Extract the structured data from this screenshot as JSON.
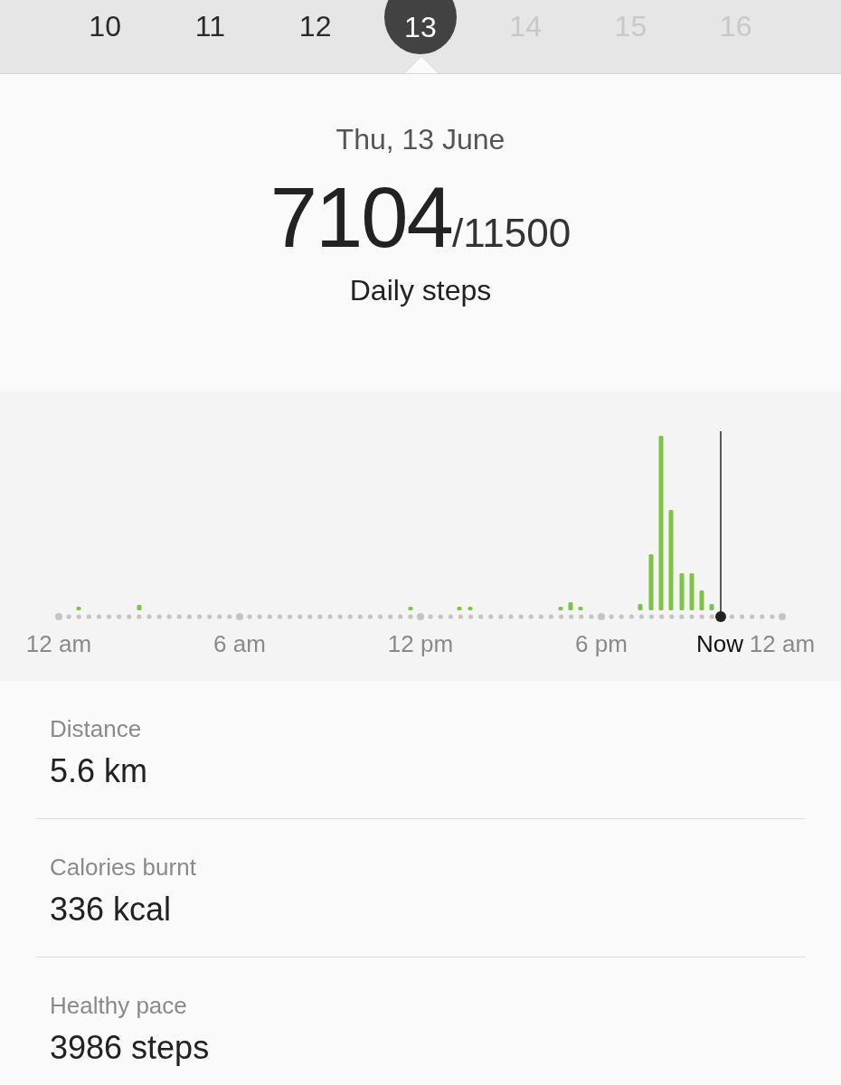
{
  "dates": [
    {
      "label": "10",
      "selected": false,
      "disabled": false
    },
    {
      "label": "11",
      "selected": false,
      "disabled": false
    },
    {
      "label": "12",
      "selected": false,
      "disabled": false
    },
    {
      "label": "13",
      "selected": true,
      "disabled": false
    },
    {
      "label": "14",
      "selected": false,
      "disabled": true
    },
    {
      "label": "15",
      "selected": false,
      "disabled": true
    },
    {
      "label": "16",
      "selected": false,
      "disabled": true
    }
  ],
  "summary": {
    "date": "Thu, 13 June",
    "steps": "7104",
    "goal": "/11500",
    "caption": "Daily steps"
  },
  "timeline": {
    "labels": [
      {
        "text": "12 am",
        "kind": "tick"
      },
      {
        "text": "6 am",
        "kind": "tick"
      },
      {
        "text": "12 pm",
        "kind": "tick"
      },
      {
        "text": "6 pm",
        "kind": "tick"
      },
      {
        "text": "Now",
        "kind": "now"
      },
      {
        "text": "12 am",
        "kind": "tick"
      }
    ]
  },
  "stats": [
    {
      "label": "Distance",
      "value": "5.6 km"
    },
    {
      "label": "Calories burnt",
      "value": "336 kcal"
    },
    {
      "label": "Healthy pace",
      "value": "3986 steps"
    }
  ]
}
